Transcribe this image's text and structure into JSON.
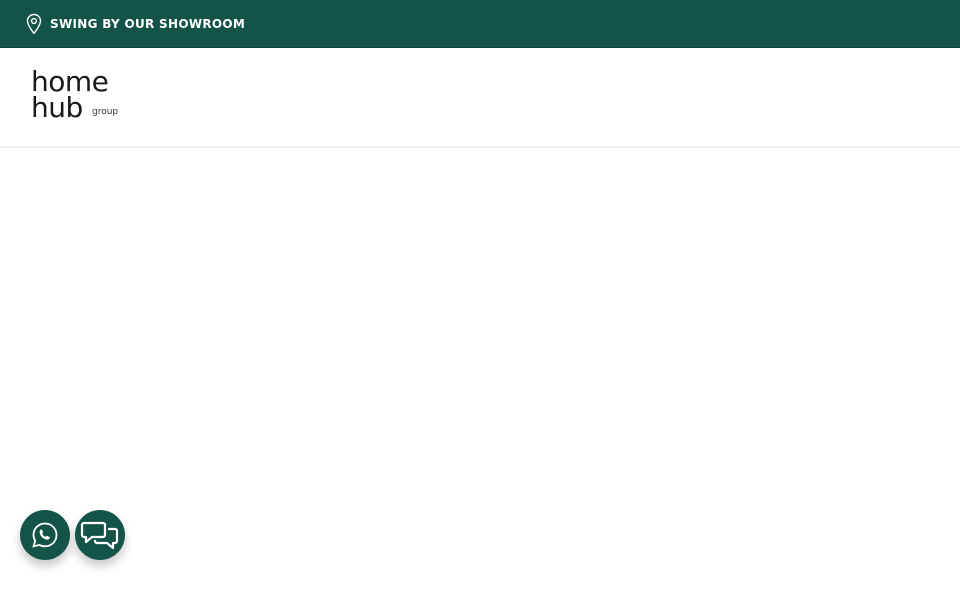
{
  "topbar": {
    "showroom_text": "SWING BY OUR SHOWROOM",
    "icon": "map-pin-icon",
    "background": "#145448"
  },
  "header": {
    "logo": {
      "line1": "home",
      "line2": "hub",
      "sub": "group"
    }
  },
  "floating_buttons": {
    "whatsapp_icon": "whatsapp-icon",
    "chat_icon": "chat-bubbles-icon",
    "color": "#145448"
  }
}
